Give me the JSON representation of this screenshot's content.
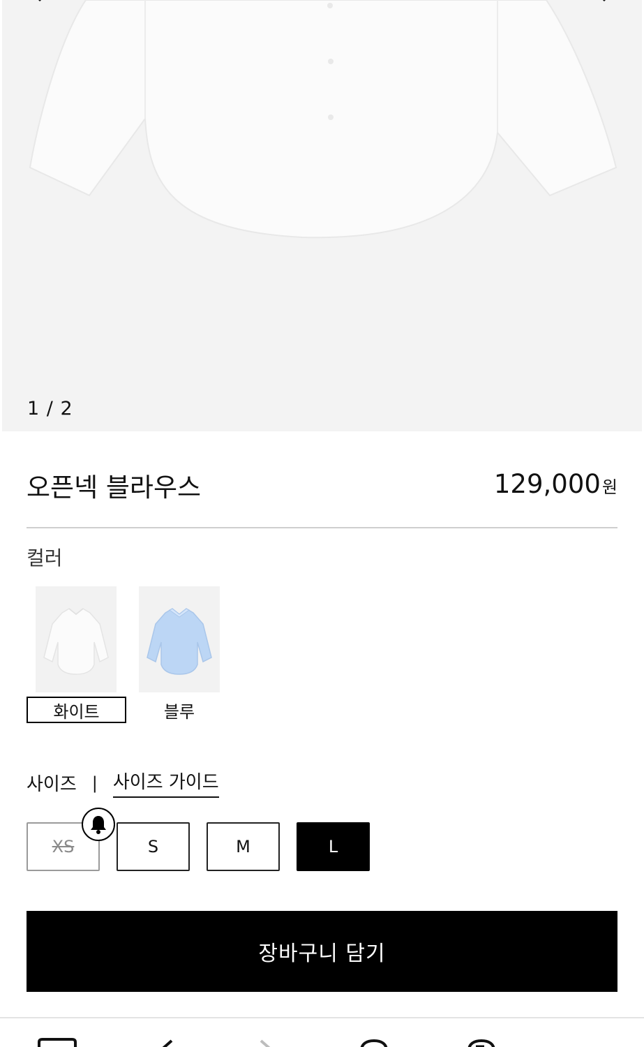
{
  "gallery": {
    "current": "1",
    "separator": "/",
    "total": "2",
    "counter_text": "1 / 2"
  },
  "product": {
    "name": "오픈넥 블라우스",
    "price": "129,000",
    "currency": "원"
  },
  "color": {
    "label": "컬러",
    "options": [
      {
        "label": "화이트",
        "selected": true,
        "swatch_color": "#f7f7f7"
      },
      {
        "label": "블루",
        "selected": false,
        "swatch_color": "#bcd6f5"
      }
    ]
  },
  "size": {
    "label": "사이즈",
    "separator": "|",
    "guide_label": "사이즈 가이드",
    "options": [
      {
        "label": "XS",
        "available": false
      },
      {
        "label": "S",
        "available": true
      },
      {
        "label": "M",
        "available": true
      },
      {
        "label": "L",
        "available": true,
        "selected": true
      }
    ]
  },
  "cart_button": {
    "label": "장바구니 담기"
  },
  "colors": {
    "accent": "#000000",
    "gallery_bg": "#f3f3f3"
  }
}
